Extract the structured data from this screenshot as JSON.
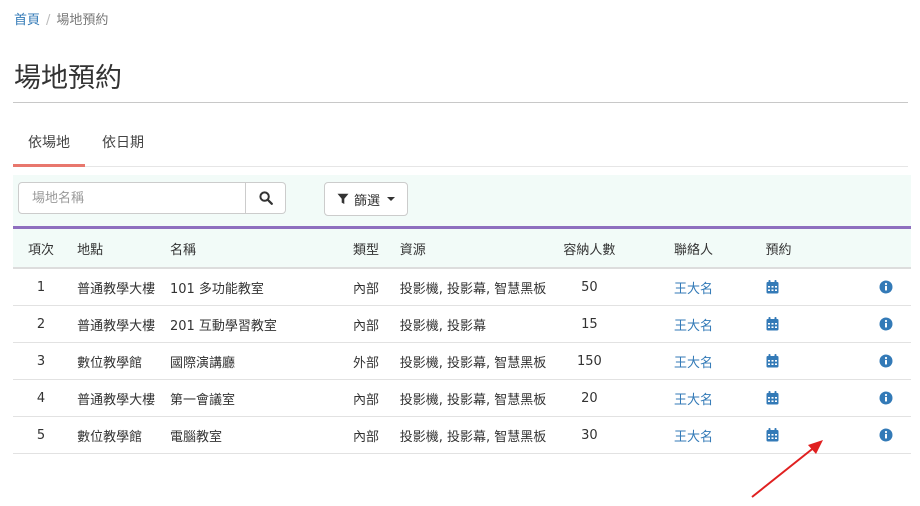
{
  "breadcrumb": {
    "home": "首頁",
    "separator": "/",
    "current": "場地預約"
  },
  "page": {
    "title": "場地預約"
  },
  "tabs": [
    {
      "label": "依場地",
      "active": true
    },
    {
      "label": "依日期",
      "active": false
    }
  ],
  "toolbar": {
    "search_placeholder": "場地名稱",
    "filter_label": "篩選"
  },
  "table": {
    "headers": {
      "no": "項次",
      "location": "地點",
      "name": "名稱",
      "type": "類型",
      "resources": "資源",
      "capacity": "容納人數",
      "contact": "聯絡人",
      "booking": "預約"
    },
    "rows": [
      {
        "no": "1",
        "location": "普通教學大樓",
        "name": "101 多功能教室",
        "type": "內部",
        "resources": "投影機, 投影幕, 智慧黑板",
        "capacity": "50",
        "contact": "王大名"
      },
      {
        "no": "2",
        "location": "普通教學大樓",
        "name": "201 互動學習教室",
        "type": "內部",
        "resources": "投影機, 投影幕",
        "capacity": "15",
        "contact": "王大名"
      },
      {
        "no": "3",
        "location": "數位教學館",
        "name": "國際演講廳",
        "type": "外部",
        "resources": "投影機, 投影幕, 智慧黑板",
        "capacity": "150",
        "contact": "王大名"
      },
      {
        "no": "4",
        "location": "普通教學大樓",
        "name": "第一會議室",
        "type": "內部",
        "resources": "投影機, 投影幕, 智慧黑板",
        "capacity": "20",
        "contact": "王大名"
      },
      {
        "no": "5",
        "location": "數位教學館",
        "name": "電腦教室",
        "type": "內部",
        "resources": "投影機, 投影幕, 智慧黑板",
        "capacity": "30",
        "contact": "王大名"
      }
    ]
  },
  "icons": {
    "search": "search-icon",
    "filter": "filter-icon",
    "booking": "calendar-icon",
    "info": "info-circle-icon",
    "annotation": "red-arrow"
  },
  "colors": {
    "link": "#337ab7",
    "tab_active": "#e8776d",
    "header_accent": "#8e6fbf",
    "toolbar_bg": "#f2fbf8",
    "arrow": "#e02020"
  }
}
